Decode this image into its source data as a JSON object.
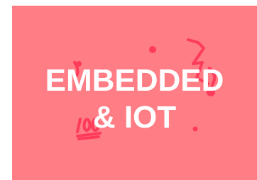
{
  "thumbnail": {
    "title_line_1": "EMBEDDED",
    "title_line_2": "& IOT",
    "background_color": "#ff7d85",
    "text_color": "#ffffff",
    "doodle_color": "#ff3b5c",
    "doodle_icons": [
      "lightning-bolt-icon",
      "hundred-points-icon",
      "dot-icon"
    ]
  }
}
